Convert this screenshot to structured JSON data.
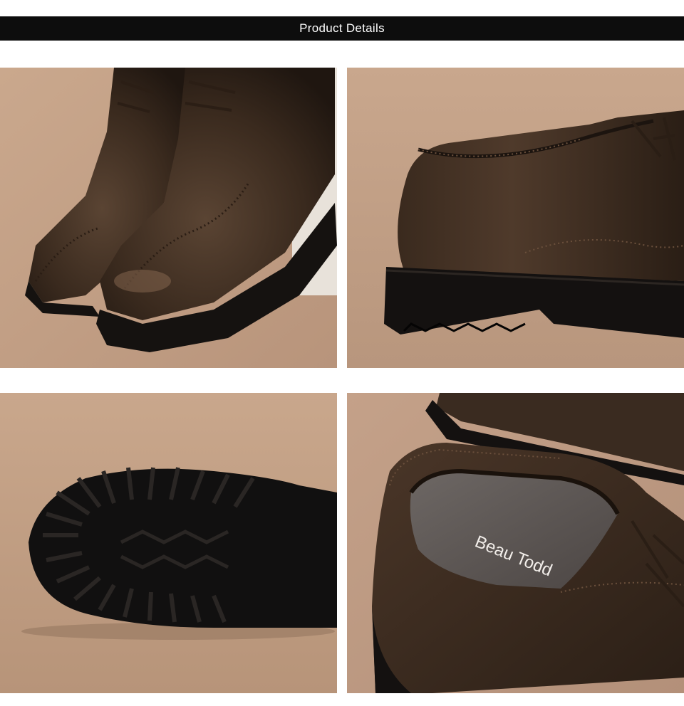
{
  "header": {
    "title": "Product Details"
  },
  "gallery": {
    "images": [
      {
        "name": "brogue-toe-closeup",
        "icon": "shoe-front-photo"
      },
      {
        "name": "shoe-heel-side-view",
        "icon": "shoe-side-photo"
      },
      {
        "name": "lug-sole-bottom-view",
        "icon": "sole-photo"
      },
      {
        "name": "insole-brand-view",
        "icon": "insole-photo",
        "insole_text": "Beau Todd"
      }
    ]
  },
  "colors": {
    "backdrop": "#c09f86",
    "leather": "#3b2b1f",
    "sole": "#151210",
    "header_bg": "#0d0d0d"
  }
}
